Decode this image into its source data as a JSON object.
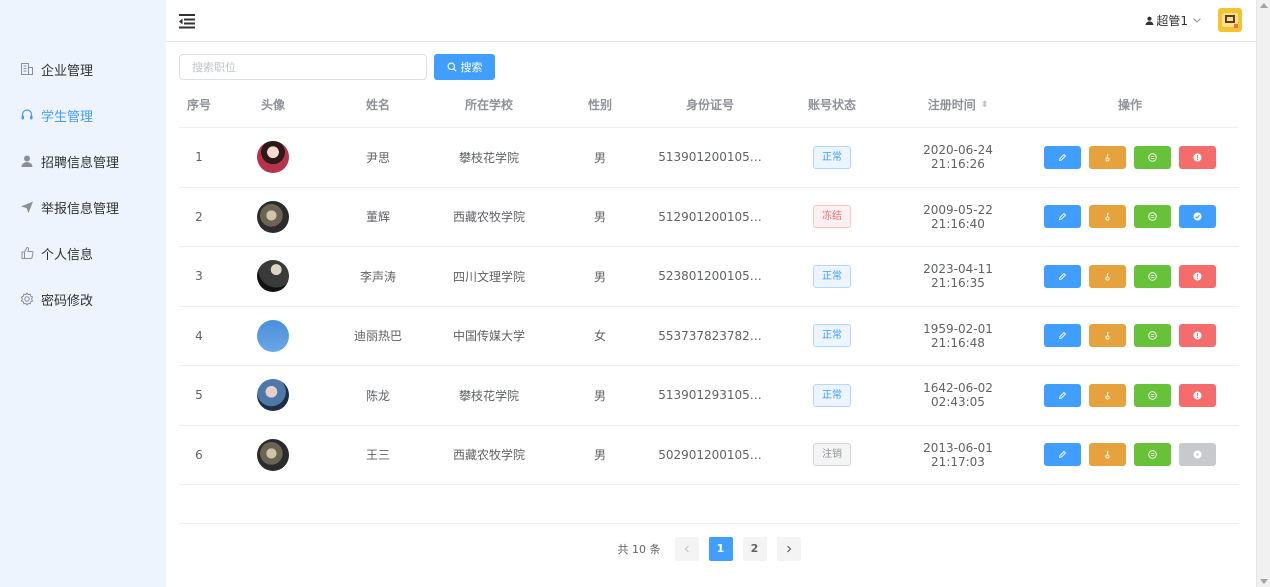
{
  "header": {
    "user_label": "超管1"
  },
  "sidebar": {
    "items": [
      {
        "label": "企业管理",
        "icon": "building-icon",
        "active": false
      },
      {
        "label": "学生管理",
        "icon": "headset-icon",
        "active": true
      },
      {
        "label": "招聘信息管理",
        "icon": "user-icon",
        "active": false
      },
      {
        "label": "举报信息管理",
        "icon": "send-icon",
        "active": false
      },
      {
        "label": "个人信息",
        "icon": "thumb-icon",
        "active": false
      },
      {
        "label": "密码修改",
        "icon": "gear-icon",
        "active": false
      }
    ]
  },
  "search": {
    "placeholder": "搜索职位",
    "button_label": "搜索"
  },
  "table": {
    "columns": [
      "序号",
      "头像",
      "姓名",
      "所在学校",
      "性别",
      "身份证号",
      "账号状态",
      "注册时间",
      "操作"
    ],
    "rows": [
      {
        "idx": "1",
        "name": "尹思",
        "school": "攀枝花学院",
        "gender": "男",
        "id_no": "513901200105…",
        "status": "正常",
        "status_type": "ok",
        "time": "2020-06-24 21:16:26",
        "last_op": "ban"
      },
      {
        "idx": "2",
        "name": "董辉",
        "school": "西藏农牧学院",
        "gender": "男",
        "id_no": "512901200105…",
        "status": "冻结",
        "status_type": "frozen",
        "time": "2009-05-22 21:16:40",
        "last_op": "unban"
      },
      {
        "idx": "3",
        "name": "李声涛",
        "school": "四川文理学院",
        "gender": "男",
        "id_no": "523801200105…",
        "status": "正常",
        "status_type": "ok",
        "time": "2023-04-11 21:16:35",
        "last_op": "ban"
      },
      {
        "idx": "4",
        "name": "迪丽热巴",
        "school": "中国传媒大学",
        "gender": "女",
        "id_no": "553737823782…",
        "status": "正常",
        "status_type": "ok",
        "time": "1959-02-01 21:16:48",
        "last_op": "ban"
      },
      {
        "idx": "5",
        "name": "陈龙",
        "school": "攀枝花学院",
        "gender": "男",
        "id_no": "513901293105…",
        "status": "正常",
        "status_type": "ok",
        "time": "1642-06-02 02:43:05",
        "last_op": "ban"
      },
      {
        "idx": "6",
        "name": "王三",
        "school": "西藏农牧学院",
        "gender": "男",
        "id_no": "502901200105…",
        "status": "注销",
        "status_type": "cancel",
        "time": "2013-06-01 21:17:03",
        "last_op": "disabled"
      }
    ]
  },
  "pagination": {
    "total_label": "共 10 条",
    "pages": [
      "1",
      "2"
    ],
    "current": "1"
  },
  "colors": {
    "primary": "#409eff",
    "warning": "#e6a23c",
    "success": "#67c23a",
    "danger": "#f56c6c",
    "sidebar_bg": "#eef4fd"
  }
}
